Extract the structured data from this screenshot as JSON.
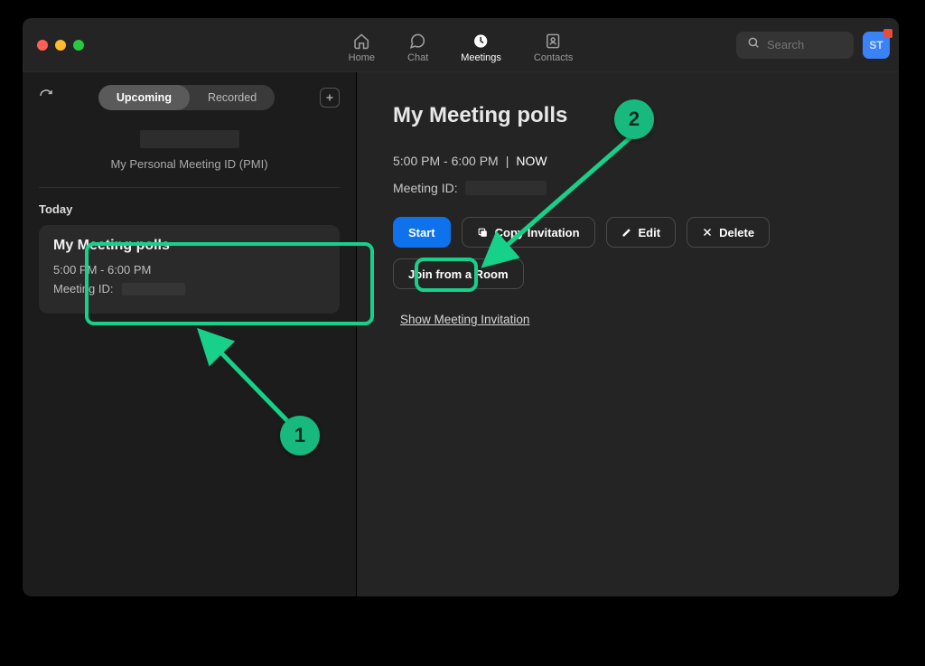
{
  "nav": {
    "home": "Home",
    "chat": "Chat",
    "meetings": "Meetings",
    "contacts": "Contacts"
  },
  "search": {
    "placeholder": "Search"
  },
  "avatar": {
    "initials": "ST"
  },
  "sidebar": {
    "tabs": {
      "upcoming": "Upcoming",
      "recorded": "Recorded"
    },
    "pmi_label": "My Personal Meeting ID (PMI)",
    "today_label": "Today",
    "meeting": {
      "title": "My Meeting polls",
      "time": "5:00 PM - 6:00 PM",
      "id_label": "Meeting ID:"
    }
  },
  "detail": {
    "title": "My Meeting polls",
    "time": "5:00 PM - 6:00 PM",
    "now_separator": "|",
    "now_label": "NOW",
    "id_label": "Meeting ID:",
    "buttons": {
      "start": "Start",
      "copy": "Copy Invitation",
      "edit": "Edit",
      "delete": "Delete",
      "join_room": "Join from a Room"
    },
    "link": "Show Meeting Invitation"
  },
  "annotations": {
    "one": "1",
    "two": "2"
  }
}
